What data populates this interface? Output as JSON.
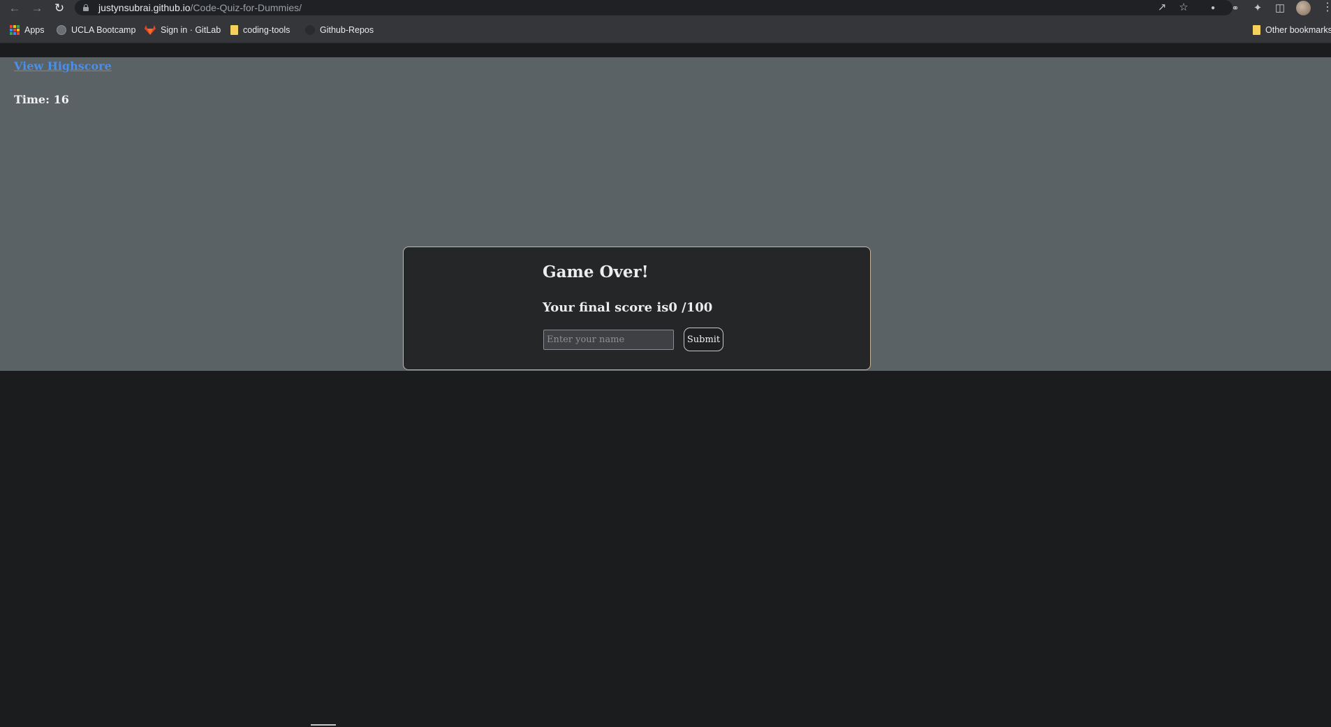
{
  "browser": {
    "url_host": "justynsubrai.github.io",
    "url_path": "/Code-Quiz-for-Dummies/",
    "nav_icons": [
      "back-arrow-icon",
      "forward-arrow-icon",
      "reload-icon"
    ],
    "bookmarks": [
      {
        "label": "Apps",
        "icon": "apps-grid-icon"
      },
      {
        "label": "UCLA Bootcamp",
        "icon": "globe-icon"
      },
      {
        "label": "Sign in · GitLab",
        "icon": "gitlab-icon"
      },
      {
        "label": "coding-tools",
        "icon": "folder-icon"
      },
      {
        "label": "Github-Repos",
        "icon": "github-icon"
      }
    ],
    "other_bookmarks": "Other bookmarks"
  },
  "page": {
    "highscore_link": "View Highscore",
    "timer": "Time: 16",
    "link_color": "#4a8fe8",
    "background_color": "#5a6266"
  },
  "card": {
    "title": "Game Over!",
    "score_text": "Your final score is0 /100",
    "name_placeholder": "Enter your name",
    "submit_label": "Submit",
    "border_color": "#c8b79a"
  }
}
